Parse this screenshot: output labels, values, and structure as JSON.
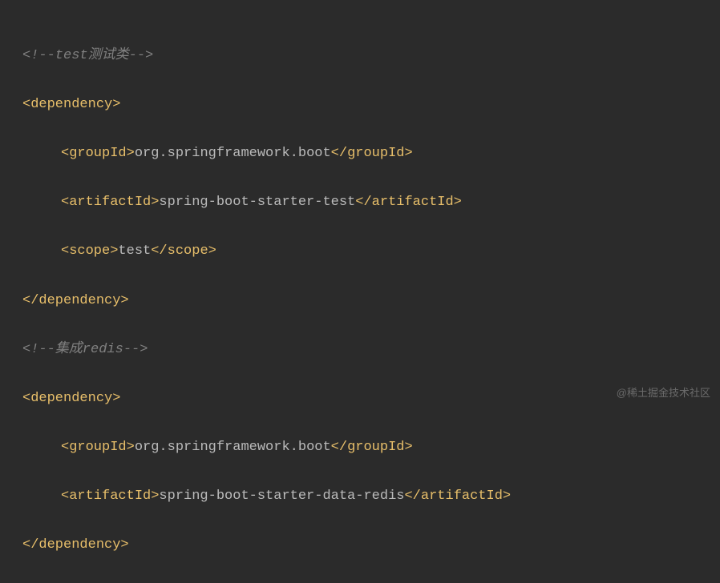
{
  "lines": {
    "comment1": "<!--test测试类-->",
    "dep_open": "<dependency>",
    "dep_close": "</dependency>",
    "group_open": "<groupId>",
    "group_close": "</groupId>",
    "artifact_open": "<artifactId>",
    "artifact_close": "</artifactId>",
    "scope_open": "<scope>",
    "scope_close": "</scope>",
    "group1_val": "org.springframework.boot",
    "artifact1_val": "spring-boot-starter-test",
    "scope1_val": "test",
    "comment2": "<!--集成redis-->",
    "group2_val": "org.springframework.boot",
    "artifact2_val": "spring-boot-starter-data-redis"
  },
  "watermark": "@稀土掘金技术社区"
}
